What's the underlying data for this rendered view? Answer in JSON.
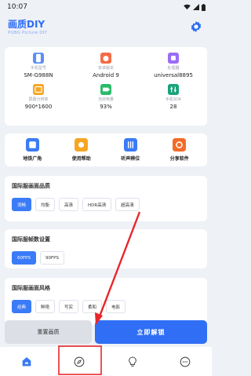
{
  "status_bar": {
    "time": "10:07"
  },
  "header": {
    "title": "画质DIY",
    "subtitle": "PUBG Picture DIY"
  },
  "device_info": [
    {
      "label": "手机型号",
      "value": "SM-G988N",
      "icon": "phone-model-icon",
      "color": "#5b8ff9"
    },
    {
      "label": "安卓版本",
      "value": "Android 9",
      "icon": "android-icon",
      "color": "#f46b45"
    },
    {
      "label": "处理器",
      "value": "universal8895",
      "icon": "processor-icon",
      "color": "#9b6cf6"
    },
    {
      "label": "屏幕分辨率",
      "value": "900*1600",
      "icon": "resolution-icon",
      "color": "#f6a623"
    },
    {
      "label": "当前电量",
      "value": "93%",
      "icon": "battery-icon",
      "color": "#2bbb6b"
    },
    {
      "label": "手机SDK",
      "value": "28",
      "icon": "sdk-icon",
      "color": "#1aa37a"
    }
  ],
  "tools": [
    {
      "label": "地铁广角",
      "icon": "wide-angle-icon",
      "color": "#3a7bf6"
    },
    {
      "label": "使用帮助",
      "icon": "help-icon",
      "color": "#f6a623"
    },
    {
      "label": "听声辨位",
      "icon": "sound-locate-icon",
      "color": "#3a7bf6"
    },
    {
      "label": "分享软件",
      "icon": "share-icon",
      "color": "#f46b2a"
    }
  ],
  "quality": {
    "title": "国际服画面品质",
    "options": [
      "流畅",
      "均衡",
      "高清",
      "HDR高清",
      "超高清"
    ],
    "selected": 0
  },
  "fps": {
    "title": "国际服帧数设置",
    "options": [
      "60FPS",
      "90FPS"
    ],
    "selected": 0
  },
  "style": {
    "title": "国际服画面风格",
    "options": [
      "经典",
      "鲜艳",
      "写实",
      "柔和",
      "电影"
    ],
    "selected": 0
  },
  "actions": {
    "reset_label": "重置画质",
    "unlock_label": "立即解锁"
  },
  "bottom_nav": [
    {
      "icon": "home-icon",
      "active": true
    },
    {
      "icon": "compass-icon",
      "active": false
    },
    {
      "icon": "lightbulb-icon",
      "active": false
    },
    {
      "icon": "more-icon",
      "active": false
    }
  ],
  "colors": {
    "accent": "#2f6ef5",
    "annotation": "#e8262b"
  }
}
